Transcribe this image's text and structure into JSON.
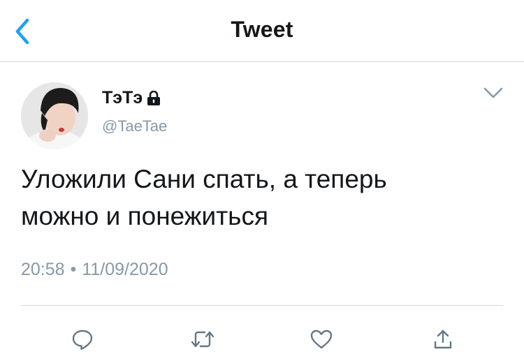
{
  "header": {
    "title": "Tweet",
    "back_icon": "chevron-left-icon"
  },
  "tweet": {
    "author": {
      "name": "ТэТэ",
      "handle": "@TaeTae",
      "locked": true
    },
    "text": "Уложили Сани спать, а теперь\nможно и понежиться",
    "time": "20:58",
    "separator": "•",
    "date": "11/09/2020"
  },
  "actions": [
    {
      "name": "reply",
      "icon": "reply-icon"
    },
    {
      "name": "retweet",
      "icon": "retweet-icon"
    },
    {
      "name": "like",
      "icon": "heart-icon"
    },
    {
      "name": "share",
      "icon": "share-icon"
    }
  ],
  "colors": {
    "accent": "#1da1f2",
    "text": "#14171a",
    "secondary": "#8899a6",
    "divider": "#d4d8db",
    "icon_gray": "#657786"
  }
}
